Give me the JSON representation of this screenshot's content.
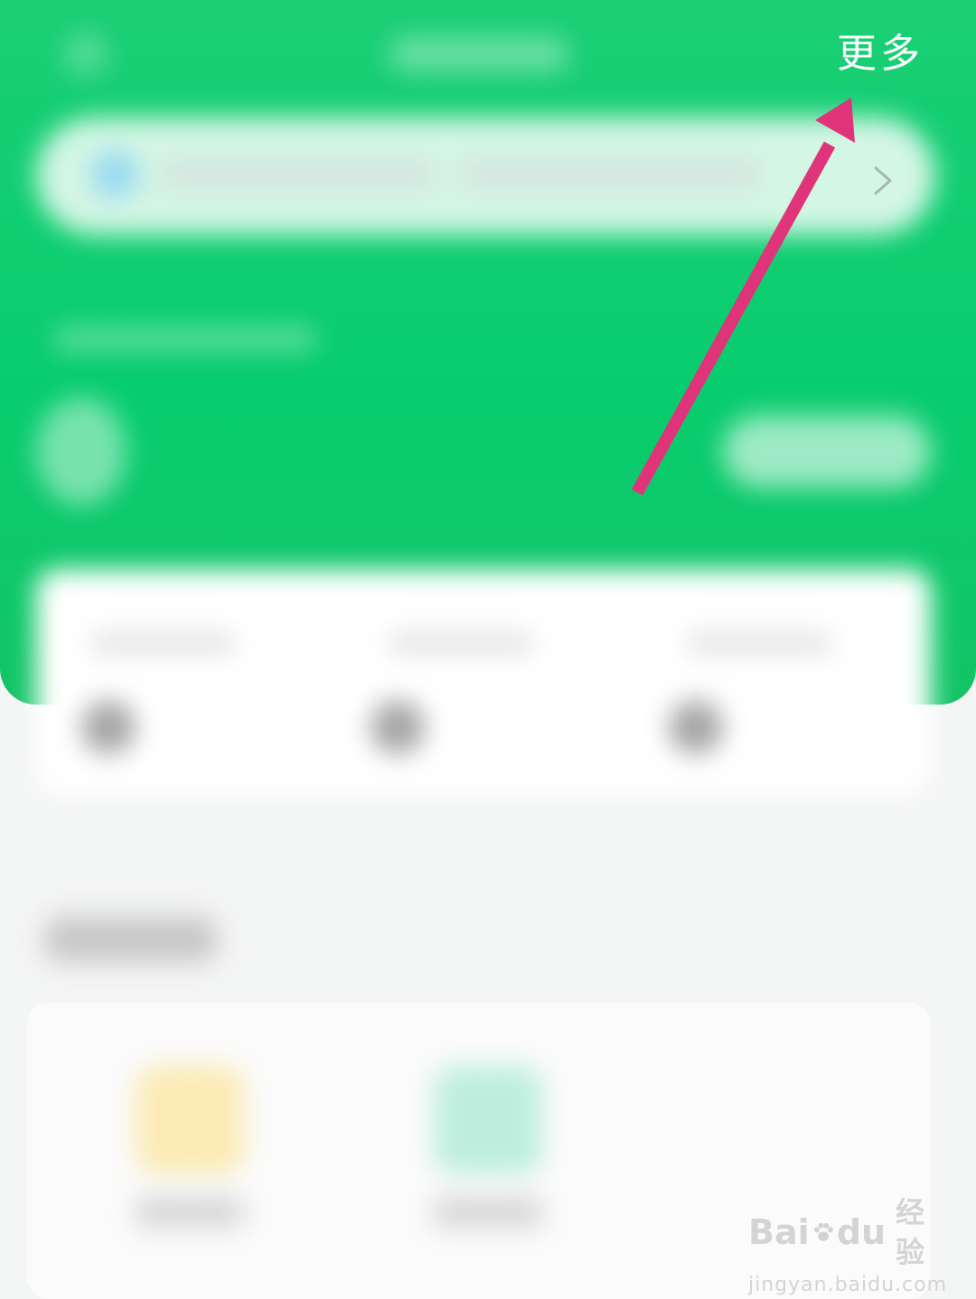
{
  "header": {
    "more_label": "更多",
    "background_color": "#08cd6e"
  },
  "notice": {
    "chevron_icon": "chevron-right-icon"
  },
  "annotation": {
    "arrow_color": "#e0347a",
    "arrow_target": "more-button"
  },
  "watermark": {
    "logo_left": "Bai",
    "logo_right": "du",
    "logo_cn": "经验",
    "url": "jingyan.baidu.com"
  }
}
